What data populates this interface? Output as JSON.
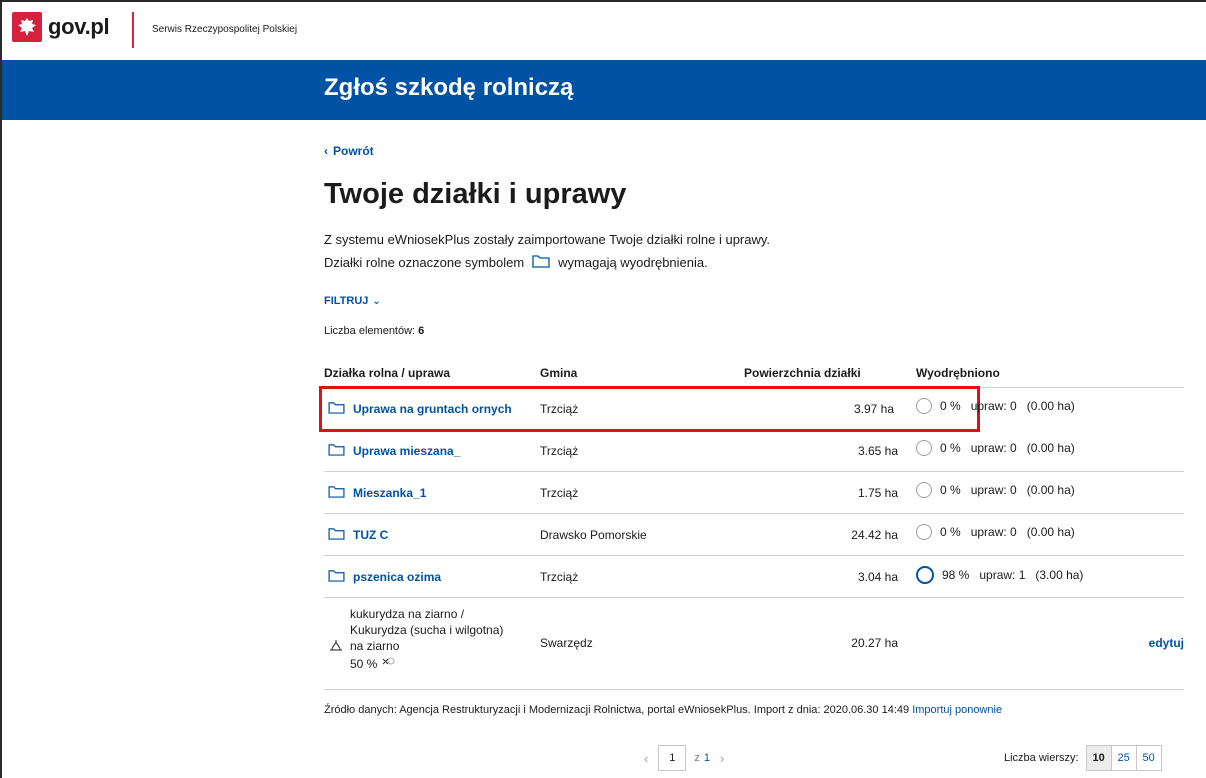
{
  "header": {
    "logo_text": "gov.pl",
    "service_name": "Serwis Rzeczypospolitej Polskiej"
  },
  "banner": {
    "title": "Zgłoś szkodę rolniczą"
  },
  "nav": {
    "back_label": "Powrót"
  },
  "page": {
    "title": "Twoje działki i uprawy",
    "intro_line1": "Z systemu eWniosekPlus zostały zaimportowane Twoje działki rolne i uprawy.",
    "intro_line2_a": "Działki rolne oznaczone symbolem",
    "intro_line2_b": "wymagają wyodrębnienia.",
    "filter_label": "FILTRUJ",
    "count_label": "Liczba elementów:",
    "count_value": "6"
  },
  "table": {
    "headers": {
      "name": "Działka rolna / uprawa",
      "gmina": "Gmina",
      "area": "Powierzchnia działki",
      "separated": "Wyodrębniono"
    },
    "rows": [
      {
        "name": "Uprawa na gruntach ornych",
        "gmina": "Trzciąż",
        "area": "3.97 ha",
        "pct": "0 %",
        "uprawy": "upraw: 0",
        "ha": "(0.00 ha)"
      },
      {
        "name": "Uprawa mieszana_",
        "gmina": "Trzciąż",
        "area": "3.65 ha",
        "pct": "0 %",
        "uprawy": "upraw: 0",
        "ha": "(0.00 ha)"
      },
      {
        "name": "Mieszanka_1",
        "gmina": "Trzciąż",
        "area": "1.75 ha",
        "pct": "0 %",
        "uprawy": "upraw: 0",
        "ha": "(0.00 ha)"
      },
      {
        "name": "TUZ C",
        "gmina": "Drawsko Pomorskie",
        "area": "24.42 ha",
        "pct": "0 %",
        "uprawy": "upraw: 0",
        "ha": "(0.00 ha)"
      },
      {
        "name": "pszenica ozima",
        "gmina": "Trzciąż",
        "area": "3.04 ha",
        "pct": "98 %",
        "uprawy": "upraw: 1",
        "ha": "(3.00 ha)"
      }
    ],
    "crop_row": {
      "line1": "kukurydza na ziarno /",
      "line2": "Kukurydza (sucha i wilgotna)",
      "line3": "na ziarno",
      "pct": "50 %",
      "gmina": "Swarzędz",
      "area": "20.27 ha",
      "edit_label": "edytuj"
    }
  },
  "source": {
    "text": "Źródło danych: Agencja Restrukturyzacji i Modernizacji Rolnictwa, portal eWniosekPlus. Import z dnia: 2020.06.30 14:49",
    "link": "Importuj ponownie"
  },
  "pagination": {
    "prev": "‹",
    "current": "1",
    "of_label": "z",
    "total": "1",
    "next": "›",
    "rows_label": "Liczba wierszy:",
    "options": [
      "10",
      "25",
      "50"
    ]
  },
  "colors": {
    "brand_blue": "#0052a5",
    "highlight_red": "#e0101a",
    "emblem_red": "#d4213d"
  }
}
